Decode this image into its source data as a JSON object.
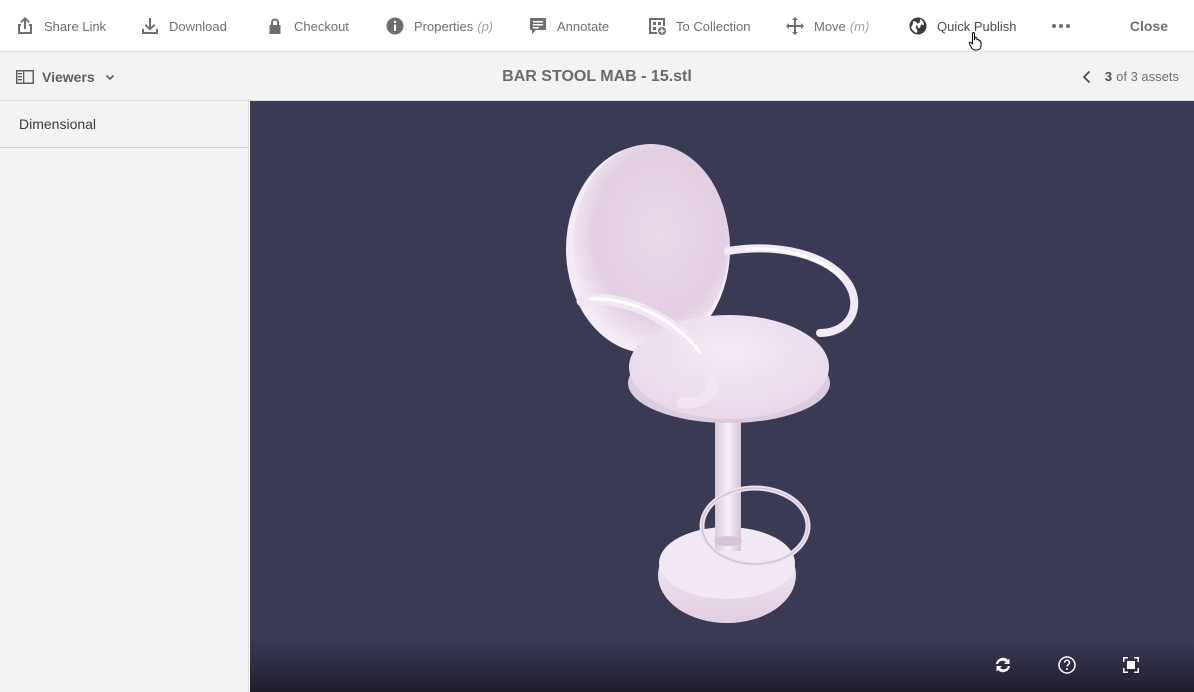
{
  "toolbar": {
    "items": [
      {
        "label": "Share Link",
        "icon": "share-icon"
      },
      {
        "label": "Download",
        "icon": "download-icon"
      },
      {
        "label": "Checkout",
        "icon": "lock-icon"
      },
      {
        "label": "Properties",
        "shortcut": "(p)",
        "icon": "info-icon"
      },
      {
        "label": "Annotate",
        "icon": "annotate-icon"
      },
      {
        "label": "To Collection",
        "icon": "collection-icon"
      },
      {
        "label": "Move",
        "shortcut": "(m)",
        "icon": "move-icon"
      },
      {
        "label": "Quick Publish",
        "icon": "globe-icon"
      }
    ],
    "more_icon": "more-icon",
    "close_label": "Close"
  },
  "subheader": {
    "viewers_label": "Viewers",
    "title": "BAR STOOL MAB - 15.stl",
    "pager": {
      "current": "3",
      "text": "of 3 assets"
    }
  },
  "rail": {
    "items": [
      {
        "label": "Dimensional"
      }
    ]
  },
  "viewer": {
    "background": "#3b3a55",
    "model_color": "#f2e6f3",
    "controls": [
      "reset-icon",
      "help-icon",
      "fullscreen-icon"
    ]
  }
}
